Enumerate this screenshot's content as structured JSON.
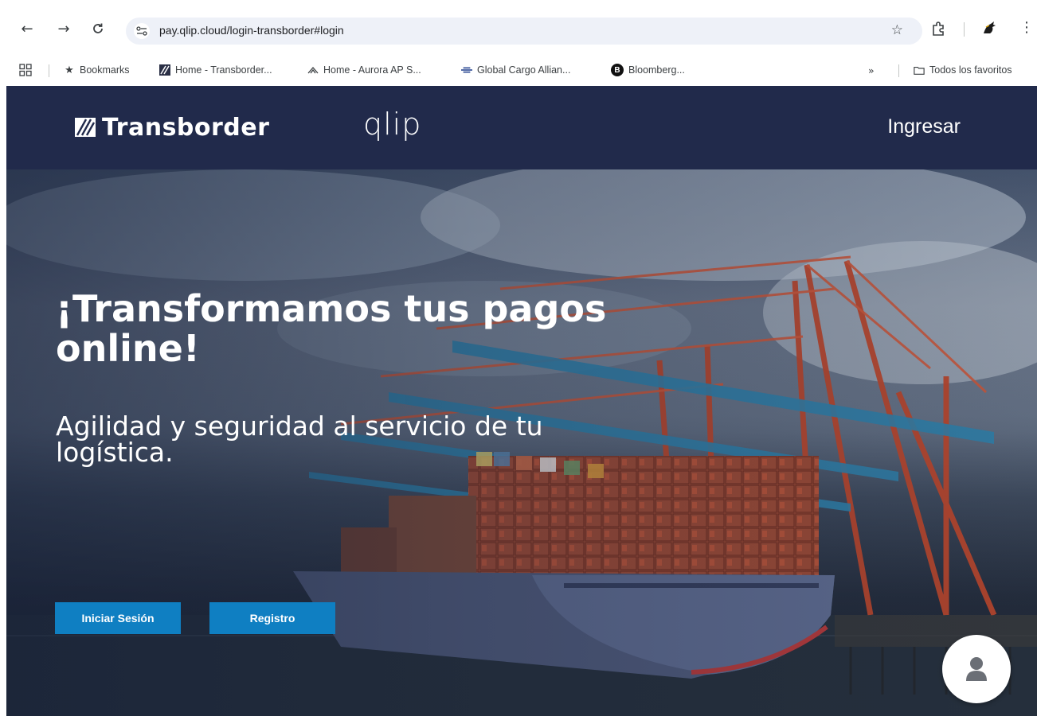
{
  "browser": {
    "url": "pay.qlip.cloud/login-transborder#login",
    "bookmarks": [
      {
        "label": "Bookmarks"
      },
      {
        "label": "Home - Transborder..."
      },
      {
        "label": "Home - Aurora AP S..."
      },
      {
        "label": "Global Cargo Allian..."
      },
      {
        "label": "Bloomberg..."
      }
    ],
    "overflow_label": "»",
    "all_bookmarks_label": "Todos los favoritos"
  },
  "header": {
    "brand": "Transborder",
    "product": "qlip",
    "login_label": "Ingresar"
  },
  "hero": {
    "title": "¡Transformamos tus pagos online!",
    "subtitle": "Agilidad y seguridad al servicio de tu logística.",
    "login_button": "Iniciar Sesión",
    "register_button": "Registro"
  },
  "colors": {
    "header_bg": "#212a4b",
    "button_blue": "#0f7fc2"
  }
}
